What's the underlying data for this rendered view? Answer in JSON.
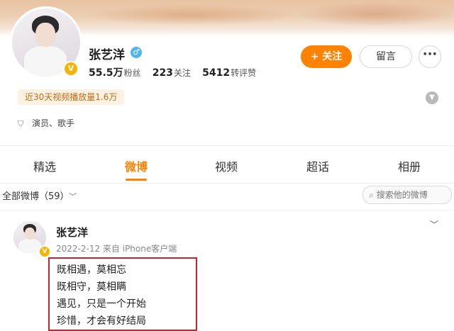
{
  "profile": {
    "name": "张艺洋",
    "stats": [
      {
        "value": "55.5万",
        "label": "粉丝"
      },
      {
        "value": "223",
        "label": "关注"
      },
      {
        "value": "5412",
        "label": "转评赞"
      }
    ],
    "video_tag": "近30天视频播放量1.6万",
    "occupation": "演员、歌手",
    "follow_label": "+ 关注",
    "message_label": "留言",
    "more_label": "···",
    "verified_badge": "V",
    "gender_symbol": "♂"
  },
  "tabs": [
    {
      "label": "精选"
    },
    {
      "label": "微博",
      "active": true
    },
    {
      "label": "视频"
    },
    {
      "label": "超话"
    },
    {
      "label": "相册"
    }
  ],
  "feed": {
    "filter_label": "全部微博（59）",
    "filter_chevron": "﹀",
    "search_placeholder": "搜索他的微博"
  },
  "post": {
    "author": "张艺洋",
    "meta": "2022-2-12 来自 iPhone客户端",
    "lines": [
      "既相遇，莫相忘",
      "既相守，莫相瞒",
      "遇见，只是一个开始",
      "珍惜，才会有好结局"
    ]
  },
  "colors": {
    "accent": "#ff8200",
    "verified": "#f6b400",
    "highlight_border": "#c8242b"
  },
  "icons": {
    "search": "search-icon",
    "expand": "chevron-down-icon",
    "more": "more-dots-icon",
    "occupation": "shield-icon"
  }
}
